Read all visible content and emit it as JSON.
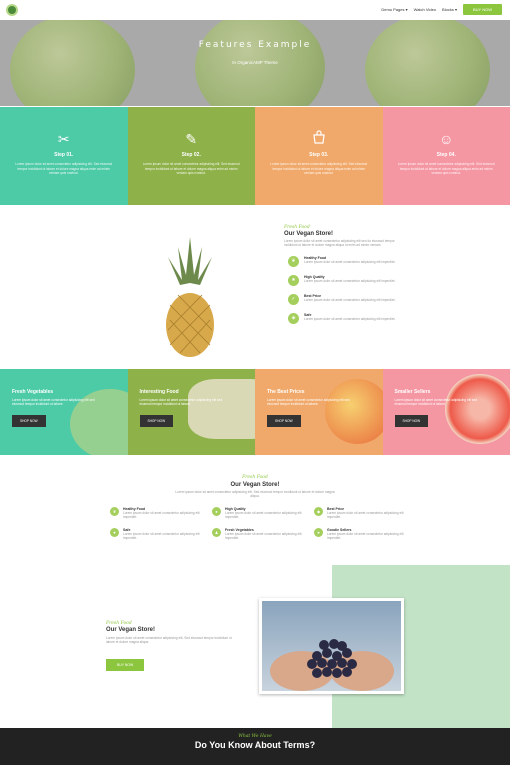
{
  "nav": {
    "items": [
      "Demo Pages",
      "Watch Video",
      "Blocks"
    ],
    "buy_label": "BUY NOW"
  },
  "hero": {
    "title": "Features Example",
    "subtitle": "In OrganicAMP Theme"
  },
  "steps": [
    {
      "icon": "scissors-icon",
      "glyph": "✂",
      "title": "Step 01.",
      "text": "Lorem ipsum dolor sit amet consectetur adipisicing elit. Sed eiusmod tempor incididunt ut labore et dolore magna aliqua enim ad minim veniam quis nostrud.",
      "color": "#4dcaa6"
    },
    {
      "icon": "brush-icon",
      "glyph": "✎",
      "title": "Step 02.",
      "text": "Lorem ipsum dolor sit amet consectetur adipisicing elit. Sed eiusmod tempor incididunt ut labore et dolore magna aliqua enim ad minim veniam quis nostrud.",
      "color": "#8fb14a"
    },
    {
      "icon": "shopping-bag-icon",
      "glyph": "🛍",
      "title": "Step 03.",
      "text": "Lorem ipsum dolor sit amet consectetur adipisicing elit. Sed eiusmod tempor incididunt ut labore et dolore magna aliqua enim ad minim veniam quis nostrud.",
      "color": "#f0a96a"
    },
    {
      "icon": "smiley-icon",
      "glyph": "☺",
      "title": "Step 04.",
      "text": "Lorem ipsum dolor sit amet consectetur adipisicing elit. Sed eiusmod tempor incididunt ut labore et dolore magna aliqua enim ad minim veniam quis nostrud.",
      "color": "#f497a3"
    }
  ],
  "vegan": {
    "script": "Fresh Food",
    "title": "Our Vegan Store!",
    "text": "Lorem ipsum dolor sit amet consectetur adipisicing elit sed do eiusmod tempor incididunt ut labore et dolore magna aliqua ut enim ad minim veniam.",
    "features": [
      {
        "name": "Healthy Food",
        "text": "Lorem ipsum dolor sit amet consectetur adipisicing elit imperdiet."
      },
      {
        "name": "High Quality",
        "text": "Lorem ipsum dolor sit amet consectetur adipisicing elit imperdiet."
      },
      {
        "name": "Best Price",
        "text": "Lorem ipsum dolor sit amet consectetur adipisicing elit imperdiet."
      },
      {
        "name": "Safe",
        "text": "Lorem ipsum dolor sit amet consectetur adipisicing elit imperdiet."
      }
    ]
  },
  "cards": [
    {
      "title": "Fresh Vegetables",
      "text": "Lorem ipsum dolor sit amet consectetur adipisicing elit sed eiusmod tempor incididunt ut labore.",
      "button": "SHOP NOW",
      "color": "#4dcaa6"
    },
    {
      "title": "Interesting Food",
      "text": "Lorem ipsum dolor sit amet consectetur adipisicing elit sed eiusmod tempor incididunt ut labore.",
      "button": "SHOP NOW",
      "color": "#8fb14a"
    },
    {
      "title": "The Best Prices",
      "text": "Lorem ipsum dolor sit amet consectetur adipisicing elit sed eiusmod tempor incididunt ut labore.",
      "button": "SHOP NOW",
      "color": "#f0a96a"
    },
    {
      "title": "Smaller Sellers",
      "text": "Lorem ipsum dolor sit amet consectetur adipisicing elit sed eiusmod tempor incididunt ut labore.",
      "button": "SHOP NOW",
      "color": "#f497a3"
    }
  ],
  "store": {
    "script": "Fresh Food",
    "title": "Our Vegan Store!",
    "text": "Lorem ipsum dolor sit amet consectetur adipisicing elit. Sed eiusmod tempor incididunt ut labore et dolore magna aliqua.",
    "items": [
      {
        "icon": "leaf-icon",
        "glyph": "❦",
        "name": "Healthy Food",
        "text": "Lorem ipsum dolor sit amet consectetur adipisicing elit imperdiet."
      },
      {
        "icon": "apple-icon",
        "glyph": "●",
        "name": "High Quality",
        "text": "Lorem ipsum dolor sit amet consectetur adipisicing elit imperdiet."
      },
      {
        "icon": "tag-icon",
        "glyph": "◆",
        "name": "Best Price",
        "text": "Lorem ipsum dolor sit amet consectetur adipisicing elit imperdiet."
      },
      {
        "icon": "heart-icon",
        "glyph": "♥",
        "name": "Safe",
        "text": "Lorem ipsum dolor sit amet consectetur adipisicing elit imperdiet."
      },
      {
        "icon": "user-icon",
        "glyph": "♟",
        "name": "Fresh Vegetables",
        "text": "Lorem ipsum dolor sit amet consectetur adipisicing elit imperdiet."
      },
      {
        "icon": "send-icon",
        "glyph": "➤",
        "name": "Goodie Sellers",
        "text": "Lorem ipsum dolor sit amet consectetur adipisicing elit imperdiet."
      }
    ]
  },
  "split": {
    "script": "Fresh Food",
    "title": "Our Vegan Store!",
    "text": "Lorem ipsum dolor sit amet consectetur adipisicing elit. Sed eiusmod tempor incididunt ut labore et dolore magna aliqua.",
    "button": "BUY NOW"
  },
  "footer": {
    "script": "What We Have",
    "title": "Do You Know About Terms?"
  }
}
